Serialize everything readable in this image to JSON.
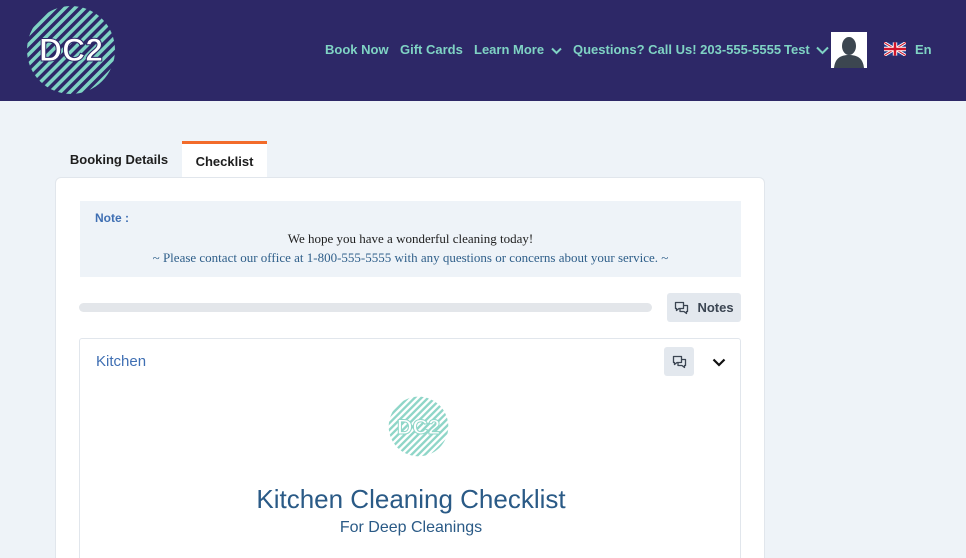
{
  "header": {
    "logo_text": "DC2",
    "nav": {
      "book_now": "Book Now",
      "gift_cards": "Gift Cards",
      "learn_more": "Learn More",
      "questions": "Questions? Call Us! 203-555-5555",
      "user": "Test"
    },
    "language": "En"
  },
  "tabs": {
    "booking_details": "Booking Details",
    "checklist": "Checklist",
    "active": "Checklist"
  },
  "note": {
    "label": "Note :",
    "line1": "We hope you have a wonderful cleaning today!",
    "line2": "~ Please contact our office at 1-800-555-5555 with any questions or concerns about your service. ~"
  },
  "progress": {
    "value": 0
  },
  "notes_button": {
    "label": "Notes",
    "icon": "chat-icon"
  },
  "section": {
    "title": "Kitchen",
    "logo_text": "DC2",
    "checklist_title": "Kitchen Cleaning Checklist",
    "checklist_subtitle": "For Deep Cleanings"
  },
  "colors": {
    "header_bg": "#2d2867",
    "accent": "#7fd3c4",
    "tab_active": "#f26b2a",
    "link_blue": "#3f6fb3"
  }
}
